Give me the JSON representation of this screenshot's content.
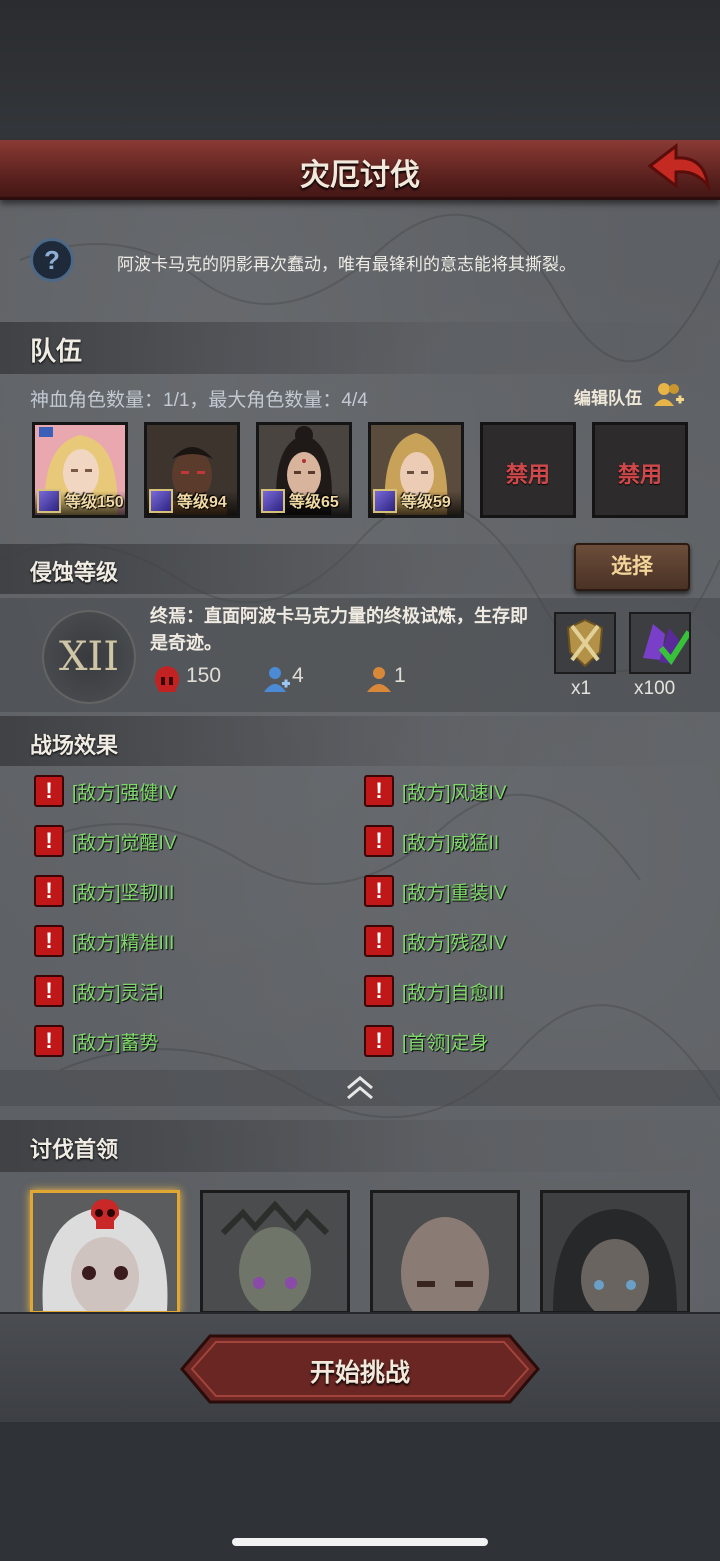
{
  "header": {
    "title": "灾厄讨伐"
  },
  "intro": {
    "text": "阿波卡马克的阴影再次蠢动，唯有最锋利的意志能将其撕裂。"
  },
  "team": {
    "section_title": "队伍",
    "stats": "神血角色数量：1/1，最大角色数量：4/4",
    "edit_label": "编辑队伍",
    "heroes": [
      {
        "level": "等级150"
      },
      {
        "level": "等级94"
      },
      {
        "level": "等级65"
      },
      {
        "level": "等级59"
      }
    ],
    "disabled_slots": [
      "禁用",
      "禁用"
    ]
  },
  "corrosion": {
    "section_title": "侵蚀等级",
    "select_label": "选择",
    "roman": "XII",
    "description": "终焉：直面阿波卡马克力量的终极试炼，生存即是奇迹。",
    "stat_power": "150",
    "stat_team": "4",
    "stat_other": "1",
    "rewards": [
      {
        "count": "x1",
        "icon": "golden-emblem-icon"
      },
      {
        "count": "x100",
        "icon": "purple-crystal-icon"
      }
    ]
  },
  "effects": {
    "section_title": "战场效果",
    "left": [
      "[敌方]强健IV",
      "[敌方]觉醒IV",
      "[敌方]坚韧III",
      "[敌方]精准III",
      "[敌方]灵活I",
      "[敌方]蓄势"
    ],
    "right": [
      "[敌方]风速IV",
      "[敌方]威猛II",
      "[敌方]重装IV",
      "[敌方]残忍IV",
      "[敌方]自愈III",
      "[首领]定身"
    ]
  },
  "bosses": {
    "section_title": "讨伐首领"
  },
  "footer": {
    "start_label": "开始挑战"
  }
}
